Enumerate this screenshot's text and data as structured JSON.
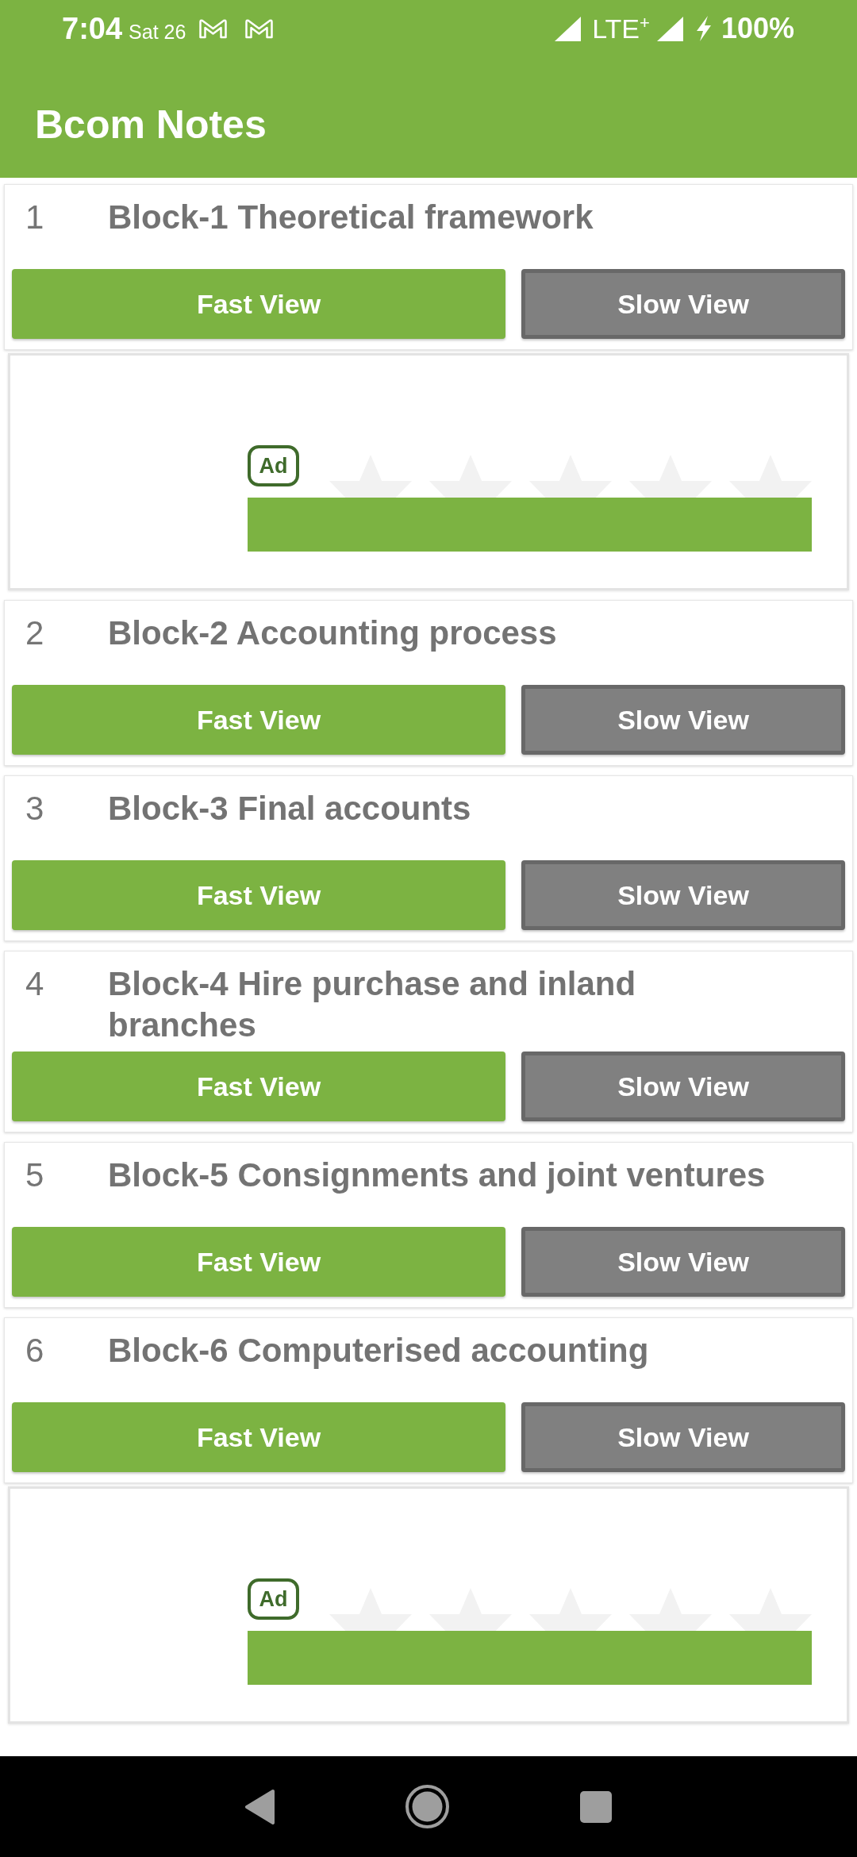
{
  "status_bar": {
    "time": "7:04",
    "date": "Sat 26",
    "network": "LTE$^{+}$",
    "battery": "100%"
  },
  "app_bar": {
    "title": "Bcom Notes"
  },
  "items": [
    {
      "kind": "block",
      "number": "1",
      "title": "Block-1 Theoretical framework",
      "buttons": [
        {
          "label": "Fast View",
          "kind": "primary"
        },
        {
          "label": "Slow View",
          "kind": "secondary"
        }
      ]
    },
    {
      "kind": "ad",
      "badge": "Ad"
    },
    {
      "kind": "block",
      "number": "2",
      "title": "Block-2 Accounting process",
      "buttons": [
        {
          "label": "Fast View",
          "kind": "primary"
        },
        {
          "label": "Slow View",
          "kind": "secondary"
        }
      ]
    },
    {
      "kind": "block",
      "number": "3",
      "title": "Block-3 Final accounts",
      "buttons": [
        {
          "label": "Fast View",
          "kind": "primary"
        },
        {
          "label": "Slow View",
          "kind": "secondary"
        }
      ]
    },
    {
      "kind": "block",
      "number": "4",
      "title": "Block-4 Hire purchase and inland branches",
      "buttons": [
        {
          "label": "Fast View",
          "kind": "primary"
        },
        {
          "label": "Slow View",
          "kind": "secondary"
        }
      ]
    },
    {
      "kind": "block",
      "number": "5",
      "title": "Block-5 Consignments and joint ventures",
      "buttons": [
        {
          "label": "Fast View",
          "kind": "primary"
        },
        {
          "label": "Slow View",
          "kind": "secondary"
        }
      ]
    },
    {
      "kind": "block",
      "number": "6",
      "title": "Block-6 Computerised accounting",
      "buttons": [
        {
          "label": "Fast View",
          "kind": "primary"
        },
        {
          "label": "Slow View",
          "kind": "secondary"
        }
      ]
    },
    {
      "kind": "ad",
      "badge": "Ad"
    }
  ]
}
